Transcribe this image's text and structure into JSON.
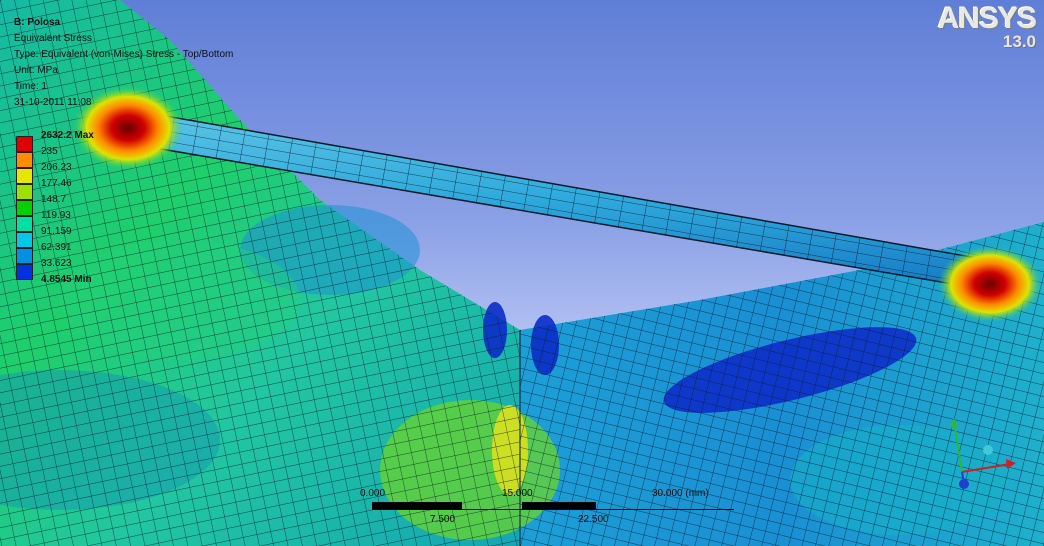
{
  "window": {
    "title": "B: Polosa",
    "result": "Equivalent Stress",
    "type": "Type: Equivalent (von-Mises) Stress - Top/Bottom",
    "unit": "Unit: MPa",
    "time": "Time: 1",
    "date": "31-10-2011 11:08"
  },
  "logo": {
    "brand": "ANSYS",
    "version": "13.0"
  },
  "legend": {
    "labels": [
      "2632.2 Max",
      "235",
      "206.23",
      "177.46",
      "148.7",
      "119.93",
      "91.159",
      "62.391",
      "33.623",
      "4.8545 Min"
    ],
    "colors": [
      "#e00000",
      "#ff8c00",
      "#e6e600",
      "#9de000",
      "#00d000",
      "#00e0a0",
      "#00c8e6",
      "#0090e0",
      "#0030e0"
    ]
  },
  "scale": {
    "labels_top": [
      "0.000",
      "15.000",
      "30.000 (mm)"
    ],
    "labels_bottom": [
      "7.500",
      "22.500"
    ]
  },
  "triad": {
    "axes": [
      "x-axis",
      "y-axis",
      "z-axis"
    ]
  },
  "colors": {
    "background_top": "#5f7ed6",
    "background_bottom": "#dfe5fb"
  }
}
